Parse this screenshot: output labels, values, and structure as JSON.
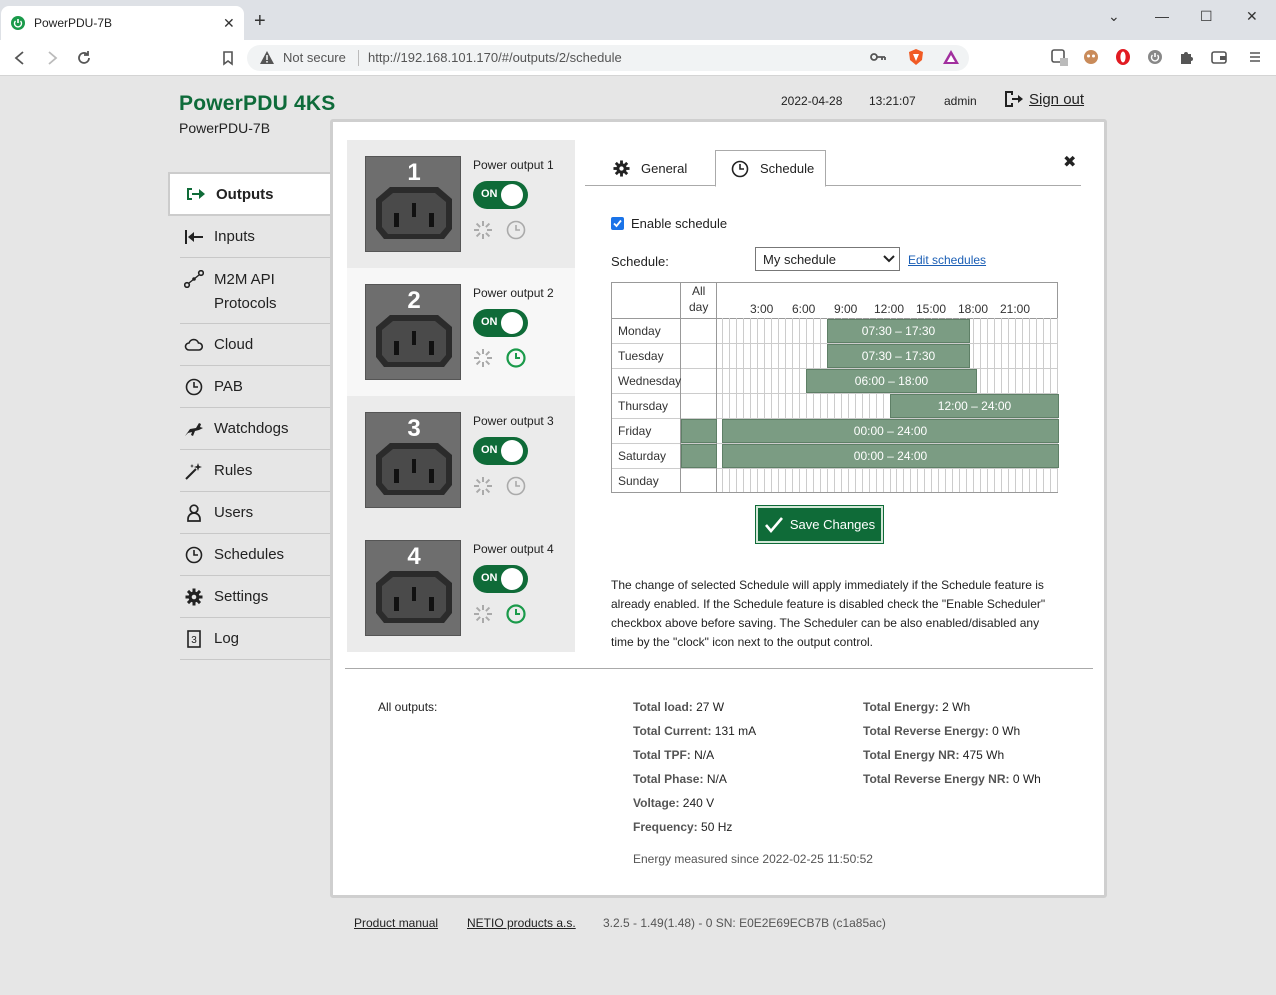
{
  "browser": {
    "tab_title": "PowerPDU-7B",
    "not_secure": "Not secure",
    "url": "http://192.168.101.170/#/outputs/2/schedule"
  },
  "header": {
    "brand": "PowerPDU 4KS",
    "device_name": "PowerPDU-7B",
    "date": "2022-04-28",
    "time": "13:21:07",
    "user": "admin",
    "sign_out": "Sign out"
  },
  "sidebar": {
    "items": [
      {
        "label": "Outputs",
        "icon": "outputs-icon"
      },
      {
        "label": "Inputs",
        "icon": "inputs-icon"
      },
      {
        "label": "M2M API",
        "label2": "Protocols",
        "icon": "m2m-icon"
      },
      {
        "label": "Cloud",
        "icon": "cloud-icon"
      },
      {
        "label": "PAB",
        "icon": "clock-icon"
      },
      {
        "label": "Watchdogs",
        "icon": "watchdog-icon"
      },
      {
        "label": "Rules",
        "icon": "rules-icon"
      },
      {
        "label": "Users",
        "icon": "user-icon"
      },
      {
        "label": "Schedules",
        "icon": "clock-icon"
      },
      {
        "label": "Settings",
        "icon": "gear-icon"
      },
      {
        "label": "Log",
        "icon": "log-icon"
      }
    ]
  },
  "outputs": [
    {
      "number": "1",
      "label": "Power output 1",
      "state": "ON",
      "schedule_enabled": false
    },
    {
      "number": "2",
      "label": "Power output 2",
      "state": "ON",
      "schedule_enabled": true
    },
    {
      "number": "3",
      "label": "Power output 3",
      "state": "ON",
      "schedule_enabled": false
    },
    {
      "number": "4",
      "label": "Power output 4",
      "state": "ON",
      "schedule_enabled": true
    }
  ],
  "detail": {
    "tabs": {
      "general": "General",
      "schedule": "Schedule"
    },
    "enable_schedule": "Enable schedule",
    "schedule_label": "Schedule:",
    "schedule_value": "My schedule",
    "edit_schedules": "Edit schedules",
    "grid": {
      "allday_1": "All",
      "allday_2": "day",
      "hours": [
        "3:00",
        "6:00",
        "9:00",
        "12:00",
        "15:00",
        "18:00",
        "21:00"
      ],
      "days": [
        "Monday",
        "Tuesday",
        "Wednesday",
        "Thursday",
        "Friday",
        "Saturday",
        "Sunday"
      ],
      "blocks": [
        {
          "day": 0,
          "label": "07:30 – 17:30"
        },
        {
          "day": 1,
          "label": "07:30 – 17:30"
        },
        {
          "day": 2,
          "label": "06:00 – 18:00"
        },
        {
          "day": 3,
          "label": "12:00 – 24:00"
        },
        {
          "day": 4,
          "label": "00:00 – 24:00"
        },
        {
          "day": 5,
          "label": "00:00 – 24:00"
        }
      ]
    },
    "save": "Save Changes",
    "note": "The change of selected Schedule will apply immediately if the Schedule feature is already enabled. If the Schedule feature is disabled check the \"Enable Scheduler\" checkbox above before saving. The Scheduler can be also enabled/disabled any time by the \"clock\" icon next to the output control."
  },
  "summary": {
    "all_outputs": "All outputs:",
    "col1": [
      {
        "label": "Total load:",
        "value": "27 W"
      },
      {
        "label": "Total Current:",
        "value": "131 mA"
      },
      {
        "label": "Total TPF:",
        "value": "N/A"
      },
      {
        "label": "Total Phase:",
        "value": "N/A"
      },
      {
        "label": "Voltage:",
        "value": "240 V"
      },
      {
        "label": "Frequency:",
        "value": "50 Hz"
      }
    ],
    "col2": [
      {
        "label": "Total Energy:",
        "value": "2 Wh"
      },
      {
        "label": "Total Reverse Energy:",
        "value": "0 Wh"
      },
      {
        "label": "Total Energy NR:",
        "value": "475 Wh"
      },
      {
        "label": "Total Reverse Energy NR:",
        "value": "0 Wh"
      }
    ],
    "since": "Energy measured since 2022-02-25 11:50:52"
  },
  "footer": {
    "manual": "Product manual",
    "company": "NETIO products a.s.",
    "version": "3.2.5 - 1.49(1.48) - 0 SN: E0E2E69ECB7B (c1a85ac)"
  },
  "colors": {
    "brand_green": "#0e6b3a",
    "block": "#7b9c83",
    "link": "#1a5eb5"
  }
}
